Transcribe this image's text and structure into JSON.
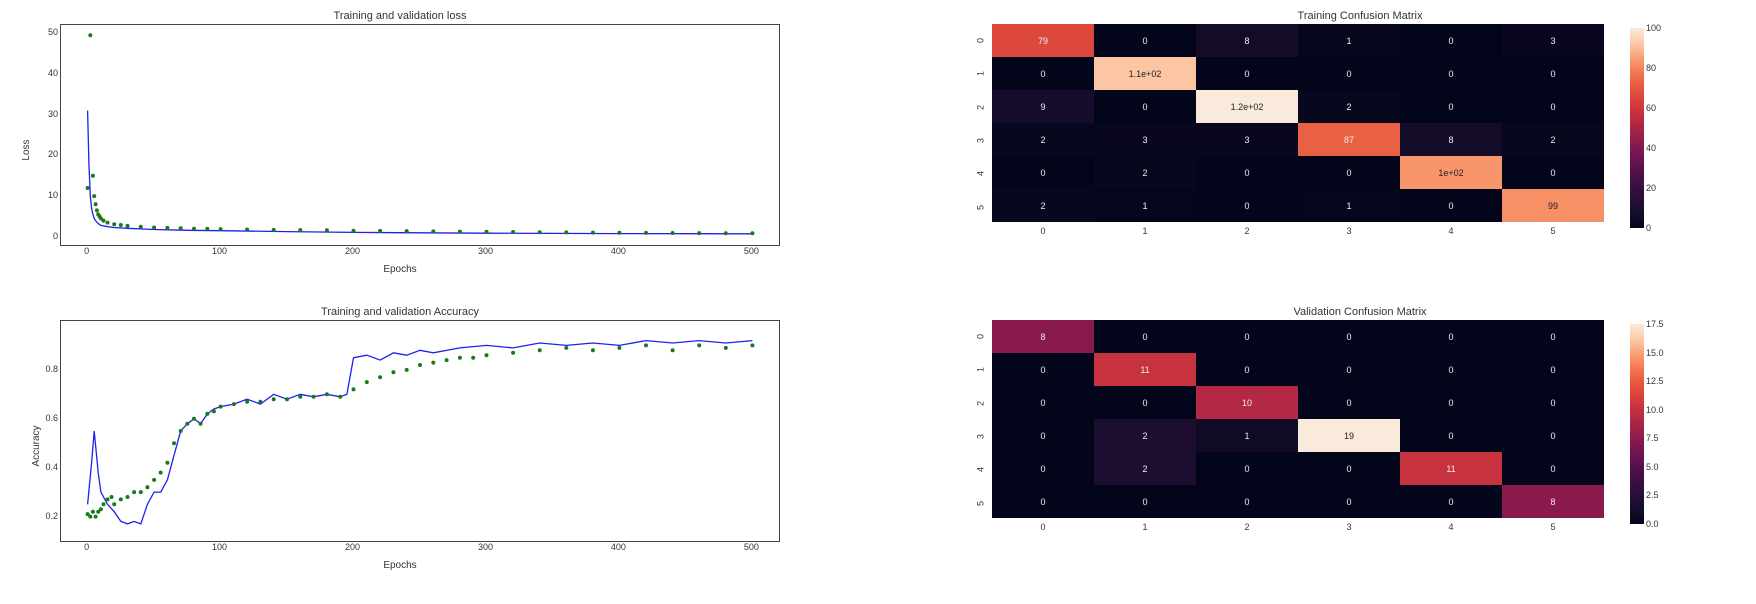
{
  "chart_data": [
    {
      "type": "line",
      "title": "Training and validation loss",
      "xlabel": "Epochs",
      "ylabel": "Loss",
      "xlim": [
        -20,
        520
      ],
      "ylim": [
        -2,
        52
      ],
      "xticks": [
        0,
        100,
        200,
        300,
        400,
        500
      ],
      "yticks": [
        0,
        10,
        20,
        30,
        40,
        50
      ],
      "series": [
        {
          "name": "validation",
          "style": "line",
          "color": "#1f1ff0",
          "x": [
            0,
            1,
            2,
            3,
            4,
            5,
            6,
            7,
            8,
            9,
            10,
            15,
            20,
            30,
            50,
            75,
            100,
            150,
            200,
            250,
            300,
            350,
            400,
            450,
            500
          ],
          "y": [
            31,
            18,
            10,
            7,
            5.5,
            4.5,
            4,
            3.6,
            3.3,
            3,
            2.8,
            2.5,
            2.3,
            2.1,
            1.8,
            1.6,
            1.5,
            1.3,
            1.1,
            1.0,
            0.9,
            0.85,
            0.8,
            0.78,
            0.75
          ]
        },
        {
          "name": "training",
          "style": "scatter",
          "color": "#1a7a1a",
          "x": [
            0,
            2,
            4,
            5,
            6,
            7,
            8,
            9,
            10,
            12,
            15,
            20,
            25,
            30,
            40,
            50,
            60,
            70,
            80,
            90,
            100,
            120,
            140,
            160,
            180,
            200,
            220,
            240,
            260,
            280,
            300,
            320,
            340,
            360,
            380,
            400,
            420,
            440,
            460,
            480,
            500
          ],
          "y": [
            12,
            49.5,
            15,
            10,
            8,
            6.5,
            5.5,
            5,
            4.5,
            4,
            3.5,
            3.1,
            2.9,
            2.7,
            2.5,
            2.3,
            2.2,
            2.1,
            2.0,
            1.95,
            1.9,
            1.8,
            1.7,
            1.65,
            1.6,
            1.5,
            1.45,
            1.4,
            1.35,
            1.3,
            1.25,
            1.2,
            1.15,
            1.1,
            1.05,
            1.0,
            0.98,
            0.95,
            0.93,
            0.9,
            0.88
          ]
        }
      ]
    },
    {
      "type": "line",
      "title": "Training and validation Accuracy",
      "xlabel": "Epochs",
      "ylabel": "Accuracy",
      "xlim": [
        -20,
        520
      ],
      "ylim": [
        0.1,
        1.0
      ],
      "xticks": [
        0,
        100,
        200,
        300,
        400,
        500
      ],
      "yticks": [
        0.2,
        0.4,
        0.6,
        0.8
      ],
      "series": [
        {
          "name": "validation",
          "style": "line",
          "color": "#1f1ff0",
          "x": [
            0,
            3,
            5,
            8,
            10,
            15,
            20,
            25,
            30,
            35,
            40,
            45,
            50,
            55,
            60,
            65,
            70,
            75,
            80,
            85,
            90,
            95,
            100,
            110,
            120,
            130,
            140,
            150,
            160,
            170,
            180,
            190,
            195,
            200,
            210,
            220,
            230,
            240,
            250,
            260,
            280,
            300,
            320,
            340,
            360,
            380,
            400,
            420,
            440,
            460,
            480,
            500
          ],
          "y": [
            0.25,
            0.42,
            0.55,
            0.38,
            0.3,
            0.25,
            0.22,
            0.18,
            0.17,
            0.18,
            0.17,
            0.25,
            0.3,
            0.3,
            0.35,
            0.45,
            0.55,
            0.58,
            0.6,
            0.58,
            0.62,
            0.64,
            0.65,
            0.66,
            0.68,
            0.66,
            0.7,
            0.68,
            0.7,
            0.69,
            0.7,
            0.69,
            0.7,
            0.85,
            0.86,
            0.84,
            0.87,
            0.86,
            0.88,
            0.87,
            0.89,
            0.9,
            0.89,
            0.91,
            0.9,
            0.91,
            0.9,
            0.92,
            0.91,
            0.92,
            0.91,
            0.92
          ]
        },
        {
          "name": "training",
          "style": "scatter",
          "color": "#1a7a1a",
          "x": [
            0,
            2,
            4,
            6,
            8,
            10,
            12,
            15,
            18,
            20,
            25,
            30,
            35,
            40,
            45,
            50,
            55,
            60,
            65,
            70,
            75,
            80,
            85,
            90,
            95,
            100,
            110,
            120,
            130,
            140,
            150,
            160,
            170,
            180,
            190,
            200,
            210,
            220,
            230,
            240,
            250,
            260,
            270,
            280,
            290,
            300,
            320,
            340,
            360,
            380,
            400,
            420,
            440,
            460,
            480,
            500
          ],
          "y": [
            0.21,
            0.2,
            0.22,
            0.2,
            0.22,
            0.23,
            0.25,
            0.27,
            0.28,
            0.25,
            0.27,
            0.28,
            0.3,
            0.3,
            0.32,
            0.35,
            0.38,
            0.42,
            0.5,
            0.55,
            0.58,
            0.6,
            0.58,
            0.62,
            0.63,
            0.65,
            0.66,
            0.67,
            0.67,
            0.68,
            0.68,
            0.69,
            0.69,
            0.7,
            0.69,
            0.72,
            0.75,
            0.77,
            0.79,
            0.8,
            0.82,
            0.83,
            0.84,
            0.85,
            0.85,
            0.86,
            0.87,
            0.88,
            0.89,
            0.88,
            0.89,
            0.9,
            0.88,
            0.9,
            0.89,
            0.9
          ]
        }
      ]
    },
    {
      "type": "heatmap",
      "title": "Training Confusion Matrix",
      "row_labels": [
        "0",
        "1",
        "2",
        "3",
        "4",
        "5"
      ],
      "col_labels": [
        "0",
        "1",
        "2",
        "3",
        "4",
        "5"
      ],
      "values": [
        [
          79,
          0,
          8,
          1,
          0,
          3
        ],
        [
          0,
          110,
          0,
          0,
          0,
          0
        ],
        [
          9,
          0,
          120,
          2,
          0,
          0
        ],
        [
          2,
          3,
          3,
          87,
          8,
          2
        ],
        [
          0,
          2,
          0,
          0,
          100,
          0
        ],
        [
          2,
          1,
          0,
          1,
          0,
          99
        ]
      ],
      "display": [
        [
          "79",
          "0",
          "8",
          "1",
          "0",
          "3"
        ],
        [
          "0",
          "1.1e+02",
          "0",
          "0",
          "0",
          "0"
        ],
        [
          "9",
          "0",
          "1.2e+02",
          "2",
          "0",
          "0"
        ],
        [
          "2",
          "3",
          "3",
          "87",
          "8",
          "2"
        ],
        [
          "0",
          "2",
          "0",
          "0",
          "1e+02",
          "0"
        ],
        [
          "2",
          "1",
          "0",
          "1",
          "0",
          "99"
        ]
      ],
      "cbar_ticks": [
        0,
        20,
        40,
        60,
        80,
        100
      ],
      "vmin": 0,
      "vmax": 120
    },
    {
      "type": "heatmap",
      "title": "Validation Confusion Matrix",
      "row_labels": [
        "0",
        "1",
        "2",
        "3",
        "4",
        "5"
      ],
      "col_labels": [
        "0",
        "1",
        "2",
        "3",
        "4",
        "5"
      ],
      "values": [
        [
          8,
          0,
          0,
          0,
          0,
          0
        ],
        [
          0,
          11,
          0,
          0,
          0,
          0
        ],
        [
          0,
          0,
          10,
          0,
          0,
          0
        ],
        [
          0,
          2,
          1,
          19,
          0,
          0
        ],
        [
          0,
          2,
          0,
          0,
          11,
          0
        ],
        [
          0,
          0,
          0,
          0,
          0,
          8
        ]
      ],
      "display": [
        [
          "8",
          "0",
          "0",
          "0",
          "0",
          "0"
        ],
        [
          "0",
          "11",
          "0",
          "0",
          "0",
          "0"
        ],
        [
          "0",
          "0",
          "10",
          "0",
          "0",
          "0"
        ],
        [
          "0",
          "2",
          "1",
          "19",
          "0",
          "0"
        ],
        [
          "0",
          "2",
          "0",
          "0",
          "11",
          "0"
        ],
        [
          "0",
          "0",
          "0",
          "0",
          "0",
          "8"
        ]
      ],
      "cbar_ticks": [
        0.0,
        2.5,
        5.0,
        7.5,
        10.0,
        12.5,
        15.0,
        17.5
      ],
      "vmin": 0,
      "vmax": 19
    }
  ]
}
